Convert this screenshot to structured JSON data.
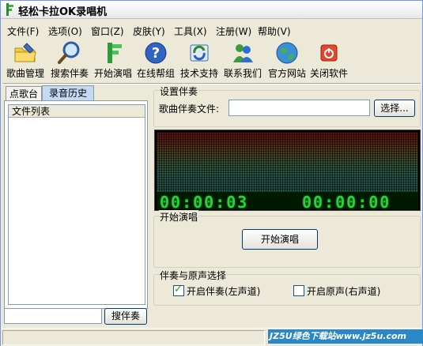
{
  "window": {
    "title": "轻松卡拉OK录唱机"
  },
  "menu": [
    "文件(F)",
    "选项(O)",
    "窗口(Z)",
    "皮肤(Y)",
    "工具(X)",
    "注册(W)",
    "帮助(V)"
  ],
  "toolbar": [
    {
      "label": "歌曲管理",
      "icon": "folder-edit-icon"
    },
    {
      "label": "搜索伴奏",
      "icon": "magnifier-icon"
    },
    {
      "label": "开始演唱",
      "icon": "microphone-icon"
    },
    {
      "label": "在线帮组",
      "icon": "help-icon"
    },
    {
      "label": "技术支持",
      "icon": "support-icon"
    },
    {
      "label": "联系我们",
      "icon": "messenger-icon"
    },
    {
      "label": "官方网站",
      "icon": "globe-icon"
    },
    {
      "label": "关闭软件",
      "icon": "power-icon"
    }
  ],
  "left": {
    "tabs": [
      "点歌台",
      "录音历史"
    ],
    "active_tab": 1,
    "list_header": "文件列表",
    "search_button": "搜伴奏"
  },
  "settings": {
    "group_title": "设置伴奏",
    "file_label": "歌曲伴奏文件:",
    "file_value": "",
    "browse_button": "选择..."
  },
  "visualizer": {
    "timer_left": "00:00:03",
    "timer_right": "00:00:00"
  },
  "sing": {
    "group_title": "开始演唱",
    "button": "开始演唱"
  },
  "channel": {
    "group_title": "伴奏与原声选择",
    "accompaniment_label": "开启伴奏(左声道)",
    "accompaniment_checked": true,
    "original_label": "开启原声(右声道)",
    "original_checked": false
  },
  "watermark": "JZ5U绿色下载站www.jz5u.com",
  "colors": {
    "accent": "#2b88c8",
    "timer_green": "#2ad03a",
    "tab_active": "#c4daf4"
  }
}
